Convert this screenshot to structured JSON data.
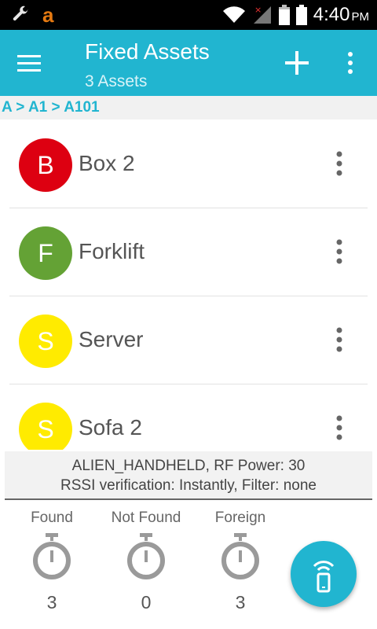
{
  "status_bar": {
    "icons_left": [
      "wrench-icon",
      "amazon-icon"
    ],
    "amazon_glyph": "a",
    "icons_right": [
      "wifi-icon",
      "signal-icon",
      "battery-icon",
      "battery-icon"
    ],
    "time": "4:40",
    "ampm": "PM"
  },
  "app_bar": {
    "title": "Fixed Assets",
    "subtitle": "3 Assets",
    "icons": [
      "menu-icon",
      "add-icon",
      "more-vert-icon"
    ]
  },
  "breadcrumb": "A > A1 > A101",
  "assets": [
    {
      "letter": "B",
      "name": "Box 2",
      "color": "#dd0011"
    },
    {
      "letter": "F",
      "name": "Forklift",
      "color": "#64a235"
    },
    {
      "letter": "S",
      "name": "Server",
      "color": "#ffeb00"
    },
    {
      "letter": "S",
      "name": "Sofa 2",
      "color": "#ffeb00"
    }
  ],
  "reader": {
    "line1": "ALIEN_HANDHELD, RF Power: 30",
    "line2": "RSSI verification: Instantly, Filter: none"
  },
  "stats": [
    {
      "label": "Found",
      "count": "3"
    },
    {
      "label": "Not Found",
      "count": "0"
    },
    {
      "label": "Foreign",
      "count": "3"
    }
  ],
  "fab": {
    "icon": "rfid-reader-icon"
  },
  "colors": {
    "accent": "#21b5d0",
    "status_bar": "#000000"
  }
}
